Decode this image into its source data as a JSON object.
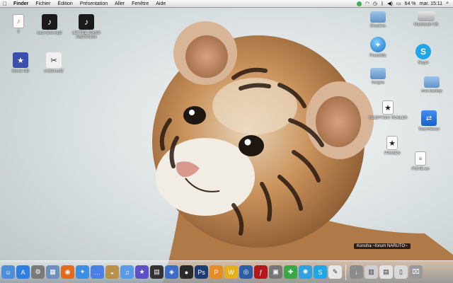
{
  "menubar": {
    "apple_icon": "apple-icon",
    "menus": [
      "Finder",
      "Fichier",
      "Édition",
      "Présentation",
      "Aller",
      "Fenêtre",
      "Aide"
    ],
    "battery": "64 %",
    "clock": "mar. 15:11"
  },
  "desktop": {
    "icons": [
      {
        "label": "2",
        "icon": "guitar-doc-icon"
      },
      {
        "label": "lucie lewi.mp3",
        "icon": "music-file-icon"
      },
      {
        "label": "LETTRE PIANO PARTITION",
        "icon": "music-file-icon"
      },
      {
        "label": "Movie HD",
        "icon": "movie-icon"
      },
      {
        "label": "evidemo32",
        "icon": "movie-thumb-icon"
      },
      {
        "label": "Dossiers",
        "icon": "folder-icon"
      },
      {
        "label": "Macintosh HD",
        "icon": "hard-drive-icon"
      },
      {
        "label": "PhotoWiz",
        "icon": "app-icon"
      },
      {
        "label": "Skype",
        "icon": "skype-icon"
      },
      {
        "label": "Images",
        "icon": "folder-icon"
      },
      {
        "label": "mes.backup",
        "icon": "folder-icon"
      },
      {
        "label": "INCEPTION TRAILER",
        "icon": "movie-icon"
      },
      {
        "label": "TeamViewer",
        "icon": "teamviewer-icon"
      },
      {
        "label": "FROZEN",
        "icon": "movie-icon"
      },
      {
        "label": "FICHE.sw",
        "icon": "document-icon"
      }
    ]
  },
  "banner": {
    "text": "Konoha ~forum NARUTO~"
  },
  "dock": {
    "items": [
      {
        "name": "finder",
        "glyph": "☺",
        "color": "#4c8fd8"
      },
      {
        "name": "app-store",
        "glyph": "A",
        "color": "#2f7fe0"
      },
      {
        "name": "system-preferences",
        "glyph": "⚙",
        "color": "#7a7a7a"
      },
      {
        "name": "preview",
        "glyph": "▦",
        "color": "#6d8fb8"
      },
      {
        "name": "firefox",
        "glyph": "◉",
        "color": "#e26a1e"
      },
      {
        "name": "safari",
        "glyph": "✦",
        "color": "#3a8fe0"
      },
      {
        "name": "ichat",
        "glyph": "…",
        "color": "#4a7fe8"
      },
      {
        "name": "dashboard",
        "glyph": "◒",
        "color": "#b8914a"
      },
      {
        "name": "itunes",
        "glyph": "♫",
        "color": "#5b9be5"
      },
      {
        "name": "imovie",
        "glyph": "★",
        "color": "#5d4fc6"
      },
      {
        "name": "clapboard",
        "glyph": "▤",
        "color": "#333333"
      },
      {
        "name": "utility",
        "glyph": "◈",
        "color": "#3b6ec4"
      },
      {
        "name": "bomb",
        "glyph": "●",
        "color": "#2a2a2a"
      },
      {
        "name": "photoshop",
        "glyph": "Ps",
        "color": "#1c3c72"
      },
      {
        "name": "app-orange",
        "glyph": "P",
        "color": "#e58d24"
      },
      {
        "name": "app-yellow",
        "glyph": "W",
        "color": "#e6b01c"
      },
      {
        "name": "globe",
        "glyph": "◎",
        "color": "#2b5ea5"
      },
      {
        "name": "flash-player",
        "glyph": "ƒ",
        "color": "#b3171b"
      },
      {
        "name": "app-grey",
        "glyph": "▣",
        "color": "#777777"
      },
      {
        "name": "app-green",
        "glyph": "✚",
        "color": "#39a848"
      },
      {
        "name": "app-star",
        "glyph": "✺",
        "color": "#2fa0e0"
      },
      {
        "name": "skype",
        "glyph": "S",
        "color": "#1fa6e8"
      },
      {
        "name": "textedit",
        "glyph": "✎",
        "color": "#e8e8e8"
      },
      {
        "name": "downloads",
        "glyph": "↓",
        "color": "#8c8c8c"
      },
      {
        "name": "stack-1",
        "glyph": "▥",
        "color": "#cfcfcf"
      },
      {
        "name": "stack-2",
        "glyph": "▤",
        "color": "#e2e2e2"
      },
      {
        "name": "stack-3",
        "glyph": "▯",
        "color": "#d9d9d9"
      },
      {
        "name": "trash",
        "glyph": "⌧",
        "color": "#9a9a9a"
      }
    ]
  }
}
